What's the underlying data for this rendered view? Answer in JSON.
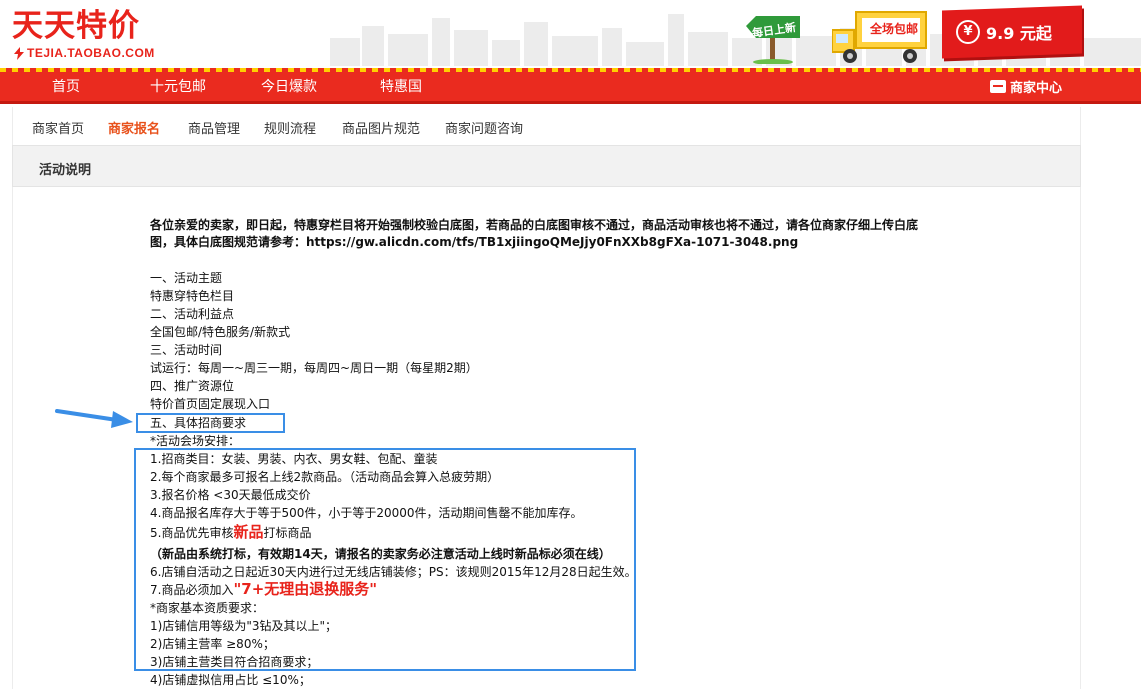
{
  "header": {
    "logo_text": "天天特价",
    "logo_sub": "TEJIA.TAOBAO.COM",
    "sign_text": "每日上新",
    "truck_text": "全场包邮",
    "price_symbol": "¥",
    "price_text": "9.9 元起"
  },
  "nav": {
    "items": [
      "首页",
      "十元包邮",
      "今日爆款",
      "特惠国"
    ],
    "merchant_label": "商家中心"
  },
  "tabs": [
    "商家首页",
    "商家报名",
    "商品管理",
    "规则流程",
    "商品图片规范",
    "商家问题咨询"
  ],
  "active_tab": "商家报名",
  "section_title": "活动说明",
  "notice_line1": "各位亲爱的卖家，即日起，特惠穿栏目将开始强制校验白底图，若商品的白底图审核不通过，商品活动审核也将不通过，请各位商家仔细上传白底",
  "notice_line2": "图，具体白底图规范请参考：https://gw.alicdn.com/tfs/TB1xjiingoQMeJjy0FnXXb8gFXa-1071-3048.png",
  "content": {
    "l1": "一、活动主题",
    "l2": "特惠穿特色栏目",
    "l3": "二、活动利益点",
    "l4": "全国包邮/特色服务/新款式",
    "l5": "三、活动时间",
    "l6": "试运行：每周一~周三一期，每周四~周日一期（每星期2期）",
    "l7": "四、推广资源位",
    "l8": "特价首页固定展现入口",
    "l9": "五、具体招商要求",
    "l10": "*活动会场安排：",
    "l11": "1.招商类目：女装、男装、内衣、男女鞋、包配、童装",
    "l12": "2.每个商家最多可报名上线2款商品。（活动商品会算入总疲劳期）",
    "l13": "3.报名价格 <30天最低成交价",
    "l14": "4.商品报名库存大于等于500件，小于等于20000件，活动期间售罄不能加库存。",
    "l15_pre": "5.商品优先审核",
    "l15_hl": "新品",
    "l15_post": "打标商品",
    "l16": "（新品由系统打标，有效期14天，请报名的卖家务必注意活动上线时新品标必须在线）",
    "l17": "6.店铺自活动之日起近30天内进行过无线店铺装修；PS：该规则2015年12月28日起生效。",
    "l18_pre": "7.商品必须加入",
    "l18_hl": "\"7+无理由退换服务\"",
    "l19": "*商家基本资质要求：",
    "l20": "1)店铺信用等级为\"3钻及其以上\"；",
    "l21": "2)店铺主营率 ≥80%；",
    "l22": "3)店铺主营类目符合招商要求；",
    "l23": "4)店铺虚拟信用占比 ≤10%；"
  },
  "colors": {
    "brand_red": "#ea2b1f",
    "accent_orange": "#e8511b",
    "annotation_blue": "#3a8ee6"
  }
}
